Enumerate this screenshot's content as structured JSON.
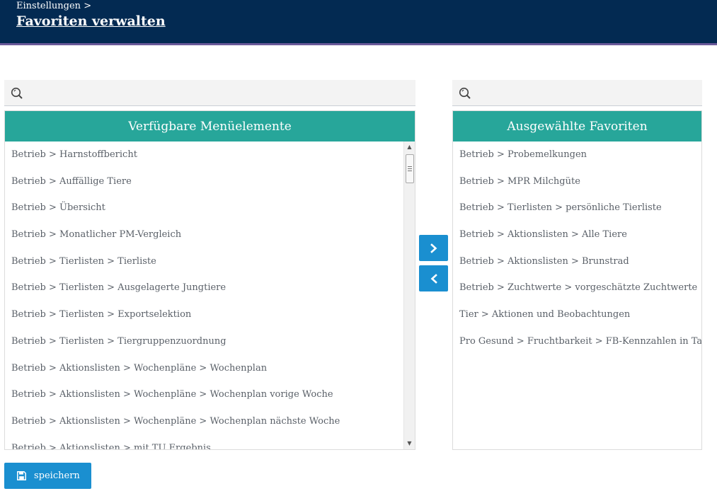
{
  "header": {
    "breadcrumb": "Einstellungen >",
    "title": "Favoriten verwalten"
  },
  "available": {
    "search_placeholder": "",
    "title": "Verfügbare Menüelemente",
    "items": [
      "Betrieb > Harnstoffbericht",
      "Betrieb > Auffällige Tiere",
      "Betrieb > Übersicht",
      "Betrieb > Monatlicher PM-Vergleich",
      "Betrieb > Tierlisten > Tierliste",
      "Betrieb > Tierlisten > Ausgelagerte Jungtiere",
      "Betrieb > Tierlisten > Exportselektion",
      "Betrieb > Tierlisten > Tiergruppenzuordnung",
      "Betrieb > Aktionslisten > Wochenpläne > Wochenplan",
      "Betrieb > Aktionslisten > Wochenpläne > Wochenplan vorige Woche",
      "Betrieb > Aktionslisten > Wochenpläne > Wochenplan nächste Woche",
      "Betrieb > Aktionslisten > mit TU Ergebnis"
    ]
  },
  "selected": {
    "search_placeholder": "",
    "title": "Ausgewählte Favoriten",
    "items": [
      "Betrieb > Probemelkungen",
      "Betrieb > MPR Milchgüte",
      "Betrieb > Tierlisten > persönliche Tierliste",
      "Betrieb > Aktionslisten > Alle Tiere",
      "Betrieb > Aktionslisten > Brunstrad",
      "Betrieb > Zuchtwerte > vorgeschätzte Zuchtwerte",
      "Tier > Aktionen und Beobachtungen",
      "Pro Gesund > Fruchtbarkeit > FB-Kennzahlen in Tagen"
    ]
  },
  "actions": {
    "add_icon": "chevron-right-icon",
    "remove_icon": "chevron-left-icon",
    "save_label": "speichern",
    "save_icon": "floppy-disk-icon"
  },
  "colors": {
    "header_bg": "#032a52",
    "header_accent": "#6b5a9a",
    "panel_header": "#27a69a",
    "button": "#1a8fd0"
  }
}
